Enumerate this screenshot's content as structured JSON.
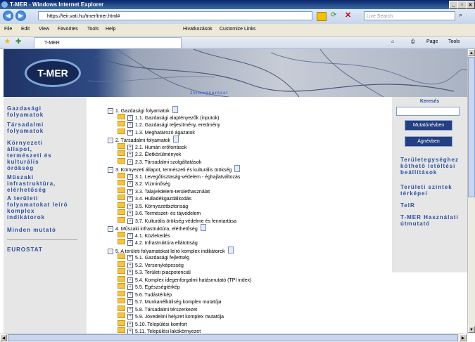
{
  "window": {
    "title": "T-MER - Windows Internet Explorer",
    "controls": [
      "_",
      "▫",
      "x"
    ]
  },
  "address_bar": {
    "url": "https://teir.vati.hu/tmer/tmer.html#",
    "search_placeholder": "Live Search"
  },
  "menu": {
    "items": [
      "File",
      "Edit",
      "View",
      "Favorites",
      "Tools",
      "Help"
    ],
    "links": [
      "Hivatkozások",
      "Customize Links"
    ]
  },
  "tab": {
    "label": "T-MER",
    "tools": [
      "Page",
      "Tools"
    ]
  },
  "banner": {
    "logo": "T-MER",
    "caption": "Jelmagyarázat"
  },
  "left_nav": {
    "items": [
      {
        "label": "Gazdasági folyamatok"
      },
      {
        "label": "Társadalmi folyamatok"
      },
      {
        "label": "Környezeti állapot, természeti és kulturális örökség"
      },
      {
        "label": "Műszaki infrastruktúra, elérhetőség"
      },
      {
        "label": "A területi folyamatokat leíró komplex indikátorok"
      },
      {
        "label": "Minden mutató"
      },
      {
        "label": "EUROSTAT"
      }
    ]
  },
  "right_nav": {
    "search_label": "Keresés",
    "btn_indicator": "Mutatónévben",
    "btn_branch": "Ágnévben",
    "links": [
      "Területegységhez köthető letöltési beállítások",
      "Területi szintek térképei",
      "TeIR",
      "T-MER Használati útmutató"
    ]
  },
  "tree": {
    "items": [
      {
        "level": 0,
        "label": "1. Gazdasági folyamatok"
      },
      {
        "level": 1,
        "label": "1.1. Gazdasági alaptényezők (inputok)"
      },
      {
        "level": 1,
        "label": "1.2. Gazdasági teljesítmény, eredmény"
      },
      {
        "level": 1,
        "label": "1.3. Meghatározó ágazatok"
      },
      {
        "level": 0,
        "label": "2. Társadalmi folyamatok"
      },
      {
        "level": 1,
        "label": "2.1. Humán erőforrások"
      },
      {
        "level": 1,
        "label": "2.2. Életkörülmények"
      },
      {
        "level": 1,
        "label": "2.3. Társadalmi szolgáltatások"
      },
      {
        "level": 0,
        "label": "3. Környezeti állapot, természeti és kulturális örökség"
      },
      {
        "level": 1,
        "label": "3.1. Levegőtisztaság-védelem - éghajlatváltozás"
      },
      {
        "level": 1,
        "label": "3.2. Vízminőség"
      },
      {
        "level": 1,
        "label": "3.3. Talajvédelem-területhasználat"
      },
      {
        "level": 1,
        "label": "3.4. Hulladékgazdálkodás"
      },
      {
        "level": 1,
        "label": "3.5. Környezetbiztonság"
      },
      {
        "level": 1,
        "label": "3.6. Természet- és tájvédelem"
      },
      {
        "level": 1,
        "label": "3.7. Kulturális örökség védelme és fenntartása"
      },
      {
        "level": 0,
        "label": "4. Műszaki infrastruktúra, elérhetőség"
      },
      {
        "level": 1,
        "label": "4.1. Közlekedés"
      },
      {
        "level": 1,
        "label": "4.2. Infrastruktúra ellátottság"
      },
      {
        "level": 0,
        "label": "5. A területi folyamatokat leíró komplex indikátorok"
      },
      {
        "level": 1,
        "label": "5.1. Gazdasági fejlettség"
      },
      {
        "level": 1,
        "label": "5.2. Versenyképesség"
      },
      {
        "level": 1,
        "label": "5.3. Területi piacpotenciál"
      },
      {
        "level": 1,
        "label": "5.4. Komplex idegenforgalmi hatásmutató (TPI index)"
      },
      {
        "level": 1,
        "label": "5.5. Egészségtérkép"
      },
      {
        "level": 1,
        "label": "5.6. Tudástérkép"
      },
      {
        "level": 1,
        "label": "5.7. Munkanélküliség komplex mutatója"
      },
      {
        "level": 1,
        "label": "5.8. Társadalmi térszerkezet"
      },
      {
        "level": 1,
        "label": "5.9. Jövedelmi helyzet komplex mutatója"
      },
      {
        "level": 1,
        "label": "5.10. Települési komfort"
      },
      {
        "level": 1,
        "label": "5.11. Települési lakókörnyezet"
      }
    ]
  }
}
